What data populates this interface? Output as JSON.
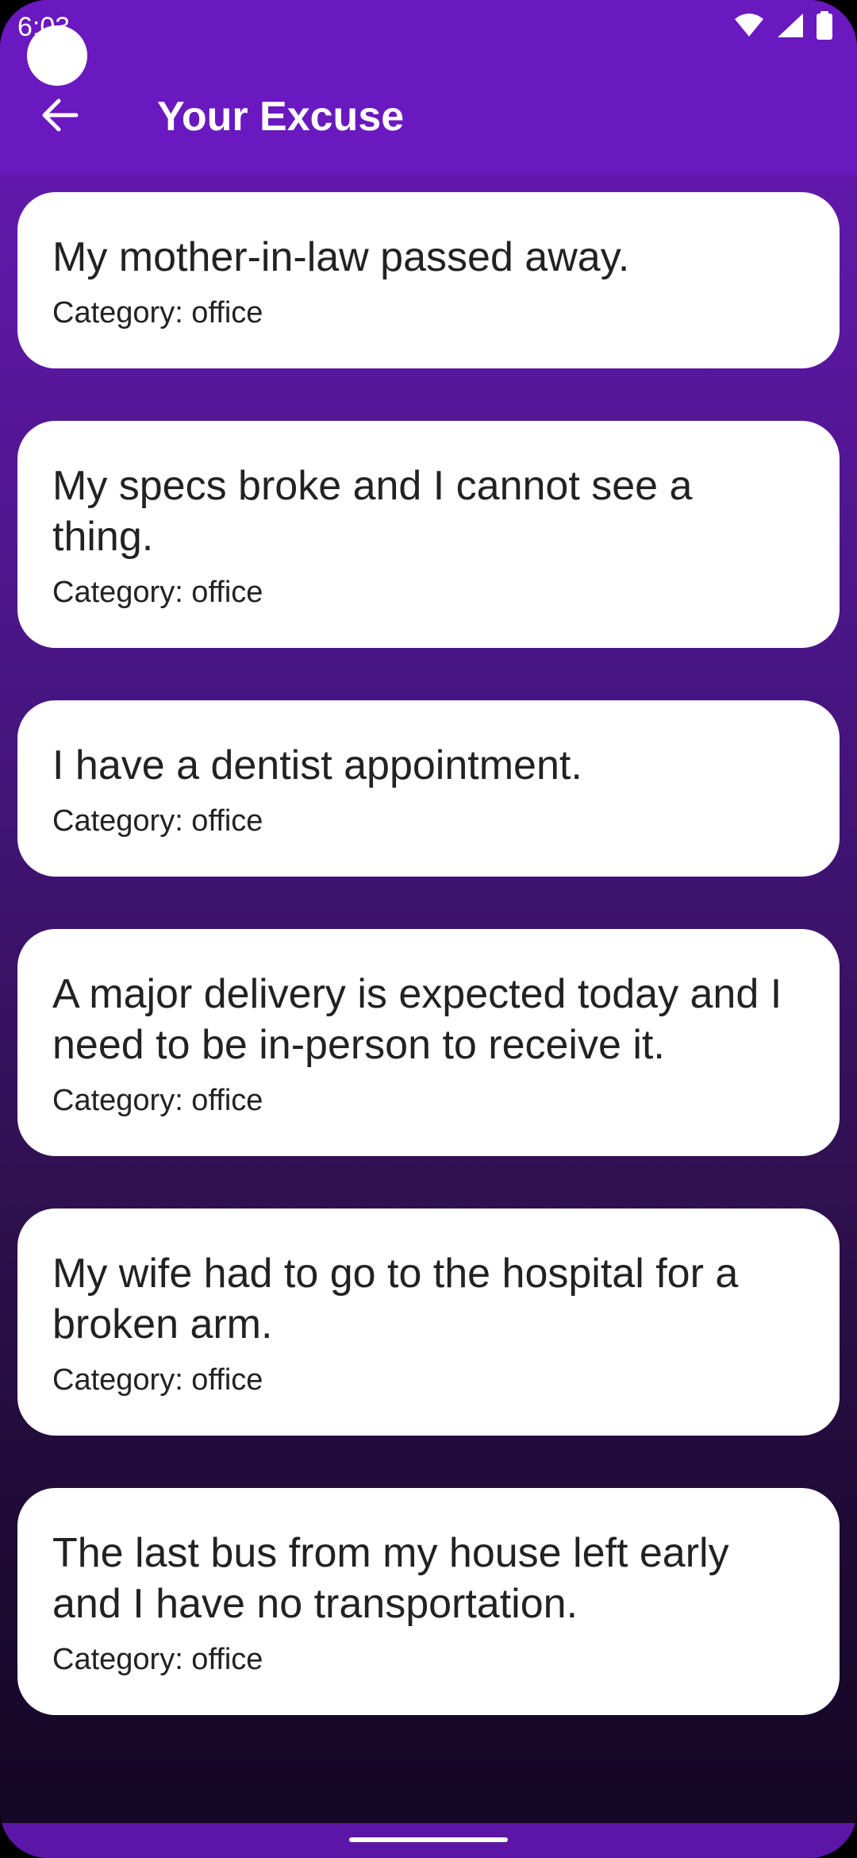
{
  "status_bar": {
    "time": "6:03"
  },
  "app_bar": {
    "title": "Your Excuse"
  },
  "excuses": [
    {
      "text": "My mother-in-law passed away.",
      "category": "Category: office"
    },
    {
      "text": "My specs broke and I cannot see a thing.",
      "category": "Category: office"
    },
    {
      "text": "I have a dentist appointment.",
      "category": "Category: office"
    },
    {
      "text": "A major delivery is expected today and I need to be in-person to receive it.",
      "category": "Category: office"
    },
    {
      "text": "My wife had to go to the hospital for a broken arm.",
      "category": "Category: office"
    },
    {
      "text": "The last bus from my house left early and I have no transportation.",
      "category": "Category: office"
    }
  ],
  "icons": {
    "back": "arrow-back-icon",
    "wifi": "wifi-icon",
    "signal": "cell-signal-icon",
    "battery": "battery-icon"
  },
  "colors": {
    "app_bar": "#6a18bf",
    "card": "#ffffff",
    "text": "#222222"
  }
}
